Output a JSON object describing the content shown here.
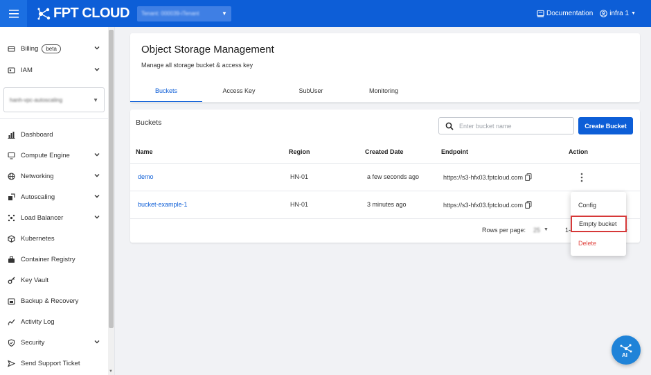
{
  "app": {
    "brand": "FPT CLOUD",
    "tenant": "Tenant: 000039-iTenant",
    "documentation": "Documentation",
    "user": "infra 1"
  },
  "sidebar": {
    "items": [
      {
        "label": "Billing",
        "badge": "beta",
        "icon": "billing-icon",
        "expandable": true
      },
      {
        "label": "IAM",
        "icon": "iam-icon",
        "expandable": true
      },
      {
        "label": "Dashboard",
        "icon": "dashboard-icon",
        "expandable": false
      },
      {
        "label": "Compute Engine",
        "icon": "monitor-icon",
        "expandable": true
      },
      {
        "label": "Networking",
        "icon": "globe-icon",
        "expandable": true
      },
      {
        "label": "Autoscaling",
        "icon": "autoscaling-icon",
        "expandable": true
      },
      {
        "label": "Load Balancer",
        "icon": "load-balancer-icon",
        "expandable": true
      },
      {
        "label": "Kubernetes",
        "icon": "cube-icon",
        "expandable": false
      },
      {
        "label": "Container Registry",
        "icon": "container-icon",
        "expandable": false
      },
      {
        "label": "Key Vault",
        "icon": "key-icon",
        "expandable": false
      },
      {
        "label": "Backup & Recovery",
        "icon": "backup-icon",
        "expandable": false
      },
      {
        "label": "Activity Log",
        "icon": "activity-icon",
        "expandable": false
      },
      {
        "label": "Security",
        "icon": "shield-icon",
        "expandable": true
      },
      {
        "label": "Send Support Ticket",
        "icon": "send-icon",
        "expandable": false
      }
    ],
    "project": "hanh-vpc-autoscaling"
  },
  "page": {
    "title": "Object Storage Management",
    "subtitle": "Manage all storage bucket & access key",
    "tabs": [
      "Buckets",
      "Access Key",
      "SubUser",
      "Monitoring"
    ],
    "active_tab": "Buckets"
  },
  "buckets": {
    "title": "Buckets",
    "search_placeholder": "Enter bucket name",
    "create_label": "Create Bucket",
    "columns": [
      "Name",
      "Region",
      "Created Date",
      "Endpoint",
      "Action"
    ],
    "rows": [
      {
        "name": "demo",
        "region": "HN-01",
        "created": "a few seconds ago",
        "endpoint": "https://s3-hfx03.fptcloud.com"
      },
      {
        "name": "bucket-example-1",
        "region": "HN-01",
        "created": "3 minutes ago",
        "endpoint": "https://s3-hfx03.fptcloud.com"
      }
    ],
    "rows_per_page_label": "Rows per page:",
    "rows_per_page": "25",
    "pagination": "1-"
  },
  "menu": {
    "items": [
      "Config",
      "Empty bucket",
      "Delete"
    ],
    "highlighted": "Empty bucket"
  },
  "colors": {
    "primary": "#0d5ed7",
    "danger": "#e0453f",
    "highlight": "#d63838"
  }
}
